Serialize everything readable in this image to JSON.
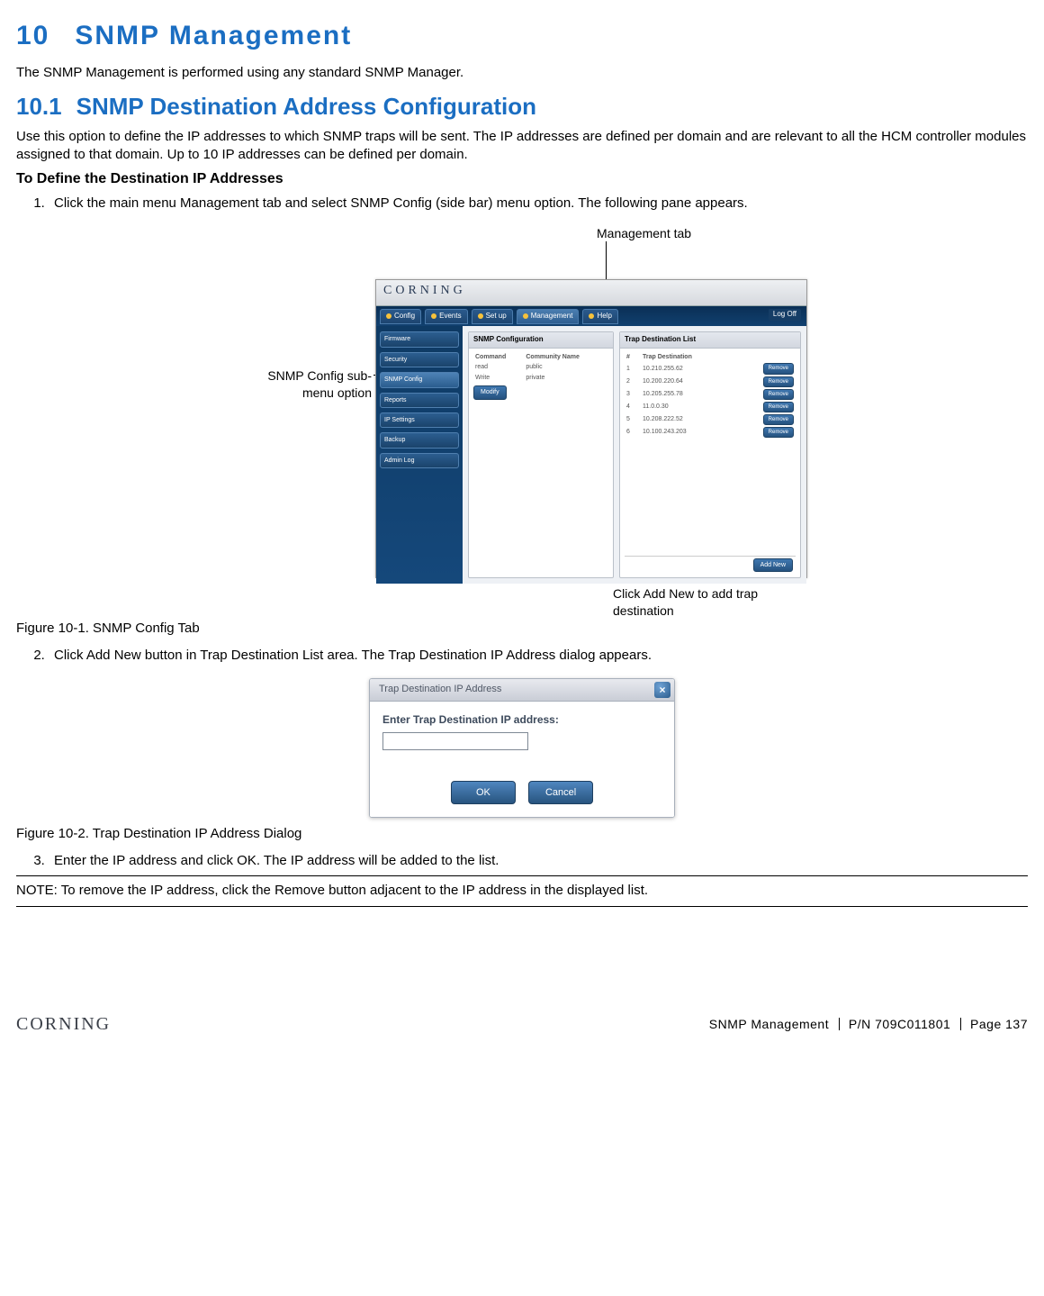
{
  "doc": {
    "h1_num": "10",
    "h1_text": "SNMP Management",
    "p_intro": "The SNMP Management is performed using any standard SNMP Manager.",
    "h2_num": "10.1",
    "h2_text": "SNMP Destination Address Configuration",
    "p_desc": "Use this option to define the IP addresses to which SNMP traps will be sent. The IP addresses are defined per domain and are relevant to all the HCM controller modules assigned to that domain. Up to 10 IP addresses can be defined per domain.",
    "p_define": "To Define the Destination IP Addresses",
    "step1": "Click the main menu Management tab and select SNMP Config (side bar) menu option. The following pane appears.",
    "fig1": "Figure 10-1. SNMP Config Tab",
    "step2": "Click Add New button in Trap Destination List area. The Trap Destination IP Address dialog appears.",
    "fig2": "Figure 10-2. Trap Destination IP Address Dialog",
    "step3": "Enter the IP address and click OK. The IP address will be added to the list.",
    "note": "NOTE: To remove the IP address, click the Remove button adjacent to the IP address in the displayed list."
  },
  "callouts": {
    "mgmt_tab": "Management tab",
    "snmp_sub": "SNMP Config sub-menu option",
    "add_new": "Click Add New to add trap destination"
  },
  "app": {
    "brand": "CORNING",
    "tabs": [
      "Config",
      "Events",
      "Set up",
      "Management",
      "Help"
    ],
    "logoff": "Log Off",
    "sidebar": [
      "Firmware",
      "Security",
      "SNMP Config",
      "Reports",
      "IP Settings",
      "Backup",
      "Admin Log"
    ],
    "panel_l_title": "SNMP Configuration",
    "panel_l_cols": [
      "Command",
      "Community Name"
    ],
    "panel_l_rows": [
      {
        "a": "read",
        "b": "public"
      },
      {
        "a": "Write",
        "b": "private"
      }
    ],
    "modify_btn": "Modify",
    "panel_r_title": "Trap Destination List",
    "panel_r_cols": [
      "#",
      "Trap Destination"
    ],
    "panel_r_rows": [
      {
        "n": "1",
        "ip": "10.210.255.62"
      },
      {
        "n": "2",
        "ip": "10.200.220.64"
      },
      {
        "n": "3",
        "ip": "10.205.255.78"
      },
      {
        "n": "4",
        "ip": "11.0.0.30"
      },
      {
        "n": "5",
        "ip": "10.208.222.52"
      },
      {
        "n": "6",
        "ip": "10.100.243.203"
      }
    ],
    "remove_btn": "Remove",
    "add_new_btn": "Add New"
  },
  "dialog": {
    "title": "Trap Destination IP Address",
    "label": "Enter Trap Destination IP address:",
    "ok": "OK",
    "cancel": "Cancel"
  },
  "footer": {
    "section": "SNMP Management",
    "pn": "P/N 709C011801",
    "page": "Page 137",
    "logo": "CORNING"
  }
}
